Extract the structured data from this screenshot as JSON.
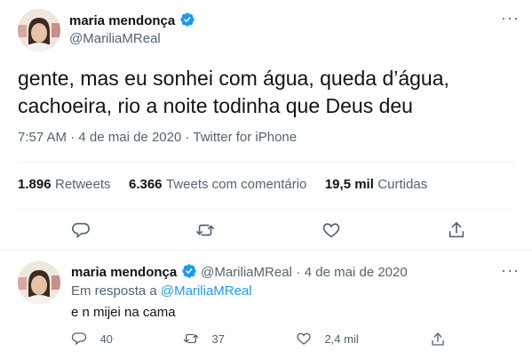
{
  "tweet": {
    "author_name": "maria mendonça",
    "author_handle": "@MariliaMReal",
    "text_line1": "gente, mas eu sonhei com água, queda d’água,",
    "text_line2": "cachoeira, rio a noite todinha que Deus deu",
    "time": "7:57 AM",
    "dot": "·",
    "date": "4 de mai de 2020",
    "source": "Twitter for iPhone",
    "stats": {
      "retweets_count": "1.896",
      "retweets_label": "Retweets",
      "quotes_count": "6.366",
      "quotes_label": "Tweets com comentário",
      "likes_count": "19,5 mil",
      "likes_label": "Curtidas"
    }
  },
  "reply": {
    "author_name": "maria mendonça",
    "author_handle": "@MariliaMReal",
    "dot": "·",
    "date": "4 de mai de 2020",
    "reply_prefix": "Em resposta a",
    "reply_to_handle": "@MariliaMReal",
    "text": "e n mijei na cama",
    "replies": "40",
    "retweets": "37",
    "likes": "2,4 mil"
  },
  "icons": {
    "verified": "verified-badge-icon",
    "more": "more-icon",
    "reply": "reply-icon",
    "retweet": "retweet-icon",
    "like": "like-icon",
    "share": "share-icon"
  },
  "colors": {
    "accent": "#1d9bf0",
    "text": "#0f1419",
    "muted": "#536471",
    "divider": "#eff3f4"
  }
}
